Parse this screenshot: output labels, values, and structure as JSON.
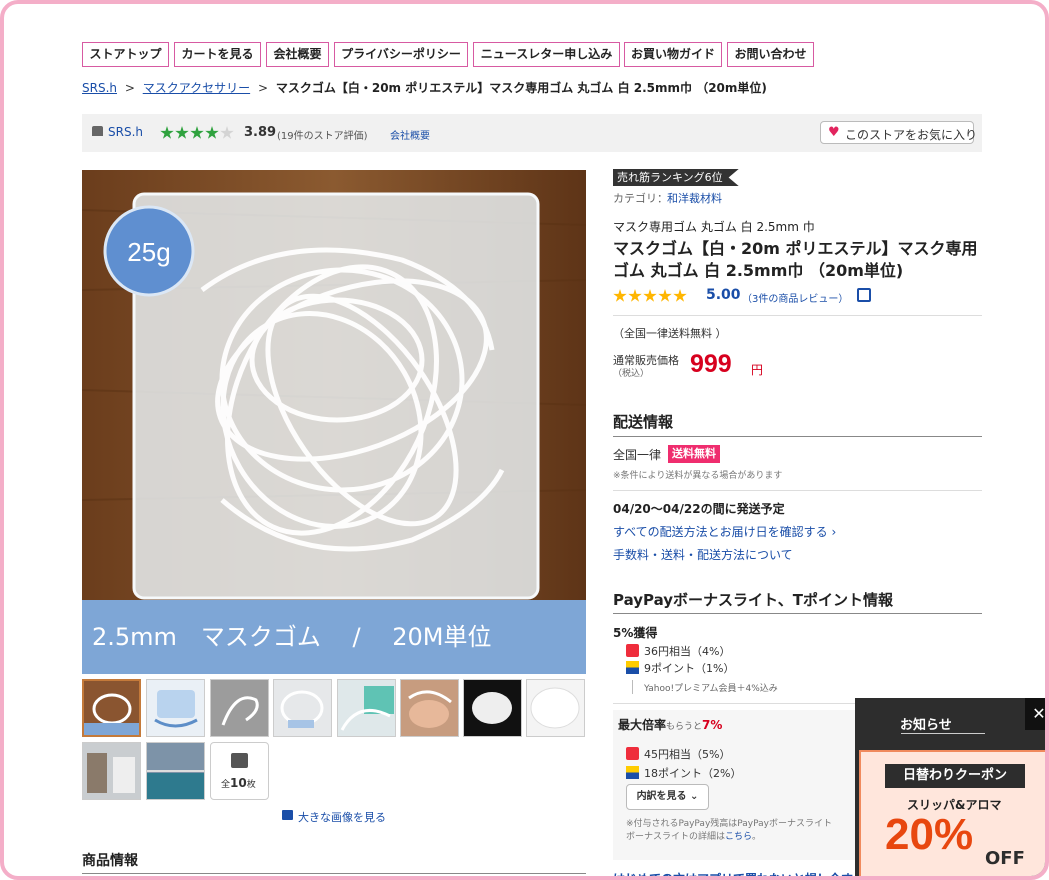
{
  "nav": [
    "ストアトップ",
    "カートを見る",
    "会社概要",
    "プライバシーポリシー",
    "ニュースレター申し込み",
    "お買い物ガイド",
    "お問い合わせ"
  ],
  "breadcrumb": {
    "store": "SRS.h",
    "category": "マスクアクセサリー",
    "sep": ">",
    "current": "マスクゴム【白・20m ポリエステル】マスク専用ゴム 丸ゴム 白 2.5mm巾 （20m単位)"
  },
  "store_bar": {
    "name": "SRS.h",
    "rating": "3.89",
    "rating_fill": 0.78,
    "rating_count": "(19件のストア評価)",
    "company": "会社概要",
    "fav_label": "このストアをお気に入り"
  },
  "main_image": {
    "badge": "25g",
    "caption": "2.5mm　マスクゴム　 /　 20M単位"
  },
  "thumbnails": {
    "count_label": "全",
    "count_value": "10",
    "count_suffix": "枚",
    "enlarge": "大きな画像を見る"
  },
  "product": {
    "ranking_badge": "売れ筋ランキング6位",
    "category_label": "カテゴリ：",
    "category_link": "和洋裁材料",
    "subtitle": "マスク専用ゴム 丸ゴム 白 2.5mm 巾",
    "title": "マスクゴム【白・20m ポリエステル】マスク専用ゴム 丸ゴム 白 2.5mm巾 （20m単位)",
    "rating": "5.00",
    "rating_fill": 1.0,
    "review_count": "（3件の商品レビュー）",
    "shipping_note": "（全国一律送料無料 ）",
    "price_label_1": "通常販売価格",
    "price_label_2": "（税込）",
    "price": "999",
    "currency": "円"
  },
  "delivery": {
    "title": "配送情報",
    "region": "全国一律",
    "free_badge": "送料無料",
    "note": "※条件により送料が異なる場合があります",
    "schedule": "04/20〜04/22の間に発送予定",
    "link_all": "すべての配送方法とお届け日を確認する ›",
    "link_fees": "手数料・送料・配送方法について"
  },
  "points": {
    "title": "PayPayボーナスライト、Tポイント情報",
    "earn": "5%獲得",
    "paypay": "36円相当（4%）",
    "tpoint": "9ポイント（1%）",
    "premium": "Yahoo!プレミアム会員＋4%込み",
    "max_label": "最大倍率",
    "max_small": "もらうと",
    "max_value": "7%",
    "max_paypay": "45円相当（5%）",
    "max_tpoint": "18ポイント（2%）",
    "breakdown_btn": "内訳を見る ⌄",
    "footnote_1": "※付与されるPayPay残高はPayPayボーナスライト",
    "footnote_2a": "ボーナスライトの詳細は",
    "footnote_2b": "こちら",
    "footnote_2c": "。"
  },
  "app_banner": "はじめての方はアプリで買わないと損！今すぐ",
  "product_info_title": "商品情報",
  "notice": {
    "title": "お知らせ",
    "close": "✕",
    "coupon_title": "日替わりクーポン",
    "coupon_sub": "スリッパ&アロマ",
    "coupon_value": "20%",
    "coupon_off": "OFF"
  },
  "colors": {
    "pink_border": "#d75aa2",
    "link_blue": "#1a4ea8",
    "price_red": "#d7001e",
    "star_yellow": "#ffb600",
    "star_green": "#2fa23e",
    "badge_pink": "#ef2d6e"
  }
}
